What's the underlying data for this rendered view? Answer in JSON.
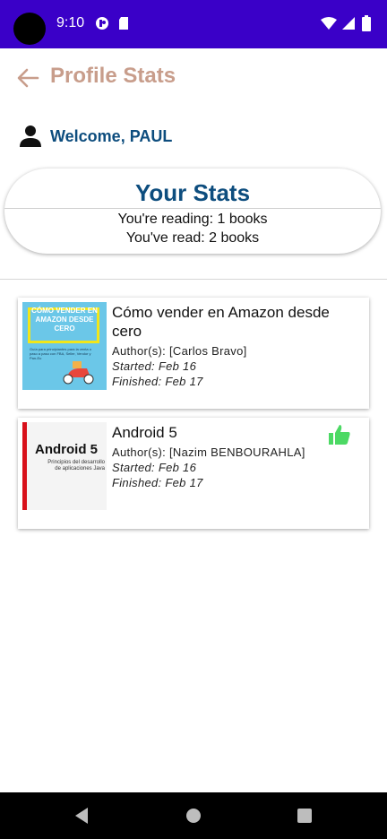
{
  "status_bar": {
    "time": "9:10",
    "background": "#3a00c8"
  },
  "toolbar": {
    "title": "Profile Stats",
    "back_icon": "arrow-left-icon",
    "title_color": "#c89d8b"
  },
  "welcome": {
    "text": "Welcome, PAUL",
    "icon": "person-icon"
  },
  "stats": {
    "title": "Your Stats",
    "reading_line": "You're reading: 1 books",
    "read_line": "You've read: 2 books",
    "accent_color": "#0d4d7e"
  },
  "books": [
    {
      "title": "Cómo vender en Amazon desde cero",
      "authors": "Author(s): [Carlos Bravo]",
      "started": "Started: Feb 16",
      "finished": "Finished: Feb 17",
      "cover_text": "CÓMO VENDER EN AMAZON DESDE CERO",
      "cover_subtitle": "Guía para principiantes para la venta o paso a paso con FBA, Seller, Vendor y Pan-Eu",
      "liked": false
    },
    {
      "title": "Android 5",
      "authors": "Author(s): [Nazim BENBOURAHLA]",
      "started": "Started: Feb 16",
      "finished": "Finished: Feb 17",
      "cover_text": "Android 5",
      "cover_subtitle": "Principios del desarrollo de aplicaciones Java",
      "liked": true,
      "like_icon": "thumb-up-icon",
      "like_color": "#4cd964"
    }
  ],
  "nav_bar": {
    "back": "back-triangle-icon",
    "home": "home-circle-icon",
    "recents": "recents-square-icon"
  }
}
